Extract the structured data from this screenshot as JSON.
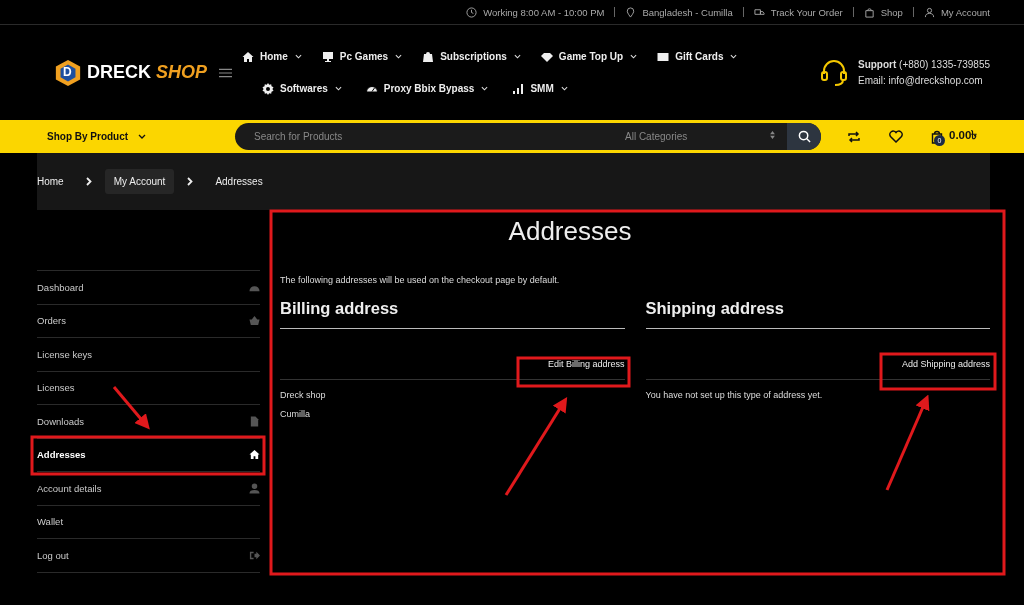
{
  "topbar": [
    {
      "kind": "clock",
      "text": "Working 8:00 AM - 10:00 PM"
    },
    {
      "kind": "pin",
      "text": "Bangladesh - Cumilla"
    },
    {
      "kind": "truck",
      "text": "Track Your Order"
    },
    {
      "kind": "bag",
      "text": "Shop"
    },
    {
      "kind": "user",
      "text": "My Account"
    }
  ],
  "logo": {
    "word1": "DRECK",
    "word2": "SHOP",
    "mark": "D"
  },
  "nav": [
    [
      {
        "kind": "home",
        "label": "Home"
      },
      {
        "kind": "monitor",
        "label": "Pc Games"
      },
      {
        "kind": "store",
        "label": "Subscriptions"
      },
      {
        "kind": "diamond",
        "label": "Game Top Up"
      },
      {
        "kind": "card",
        "label": "Gift Cards"
      }
    ],
    [
      {
        "kind": "gear",
        "label": "Softwares"
      },
      {
        "kind": "gauge",
        "label": "Proxy Bbix Bypass"
      },
      {
        "kind": "bars",
        "label": "SMM"
      }
    ]
  ],
  "support": {
    "label": "Support",
    "phone": "(+880) 1335-739855",
    "email": "Email: info@dreckshop.com"
  },
  "shop_by": "Shop By Product",
  "search": {
    "placeholder": "Search for Products",
    "category": "All Categories"
  },
  "cart": {
    "count": "0",
    "total": "0.00৳"
  },
  "breadcrumb": [
    {
      "label": "Home",
      "selected": false
    },
    {
      "label": "My Account",
      "selected": true
    },
    {
      "label": "Addresses",
      "selected": false
    }
  ],
  "sidebar": [
    {
      "label": "Dashboard",
      "kind": "gauge",
      "selected": false
    },
    {
      "label": "Orders",
      "kind": "basket",
      "selected": false
    },
    {
      "label": "License keys",
      "kind": "plain",
      "selected": false
    },
    {
      "label": "Licenses",
      "kind": "plain",
      "selected": false
    },
    {
      "label": "Downloads",
      "kind": "file",
      "selected": false
    },
    {
      "label": "Addresses",
      "kind": "home",
      "selected": true
    },
    {
      "label": "Account details",
      "kind": "user",
      "selected": false
    },
    {
      "label": "Wallet",
      "kind": "plain",
      "selected": false
    },
    {
      "label": "Log out",
      "kind": "logout",
      "selected": false
    }
  ],
  "page_title": "Addresses",
  "intro": "The following addresses will be used on the checkout page by default.",
  "addresses": [
    {
      "title": "Billing address",
      "action": "Edit Billing address",
      "lines": [
        "Dreck shop",
        "Cumilla"
      ]
    },
    {
      "title": "Shipping address",
      "action": "Add Shipping address",
      "lines": [
        "You have not set up this type of address yet."
      ]
    }
  ]
}
